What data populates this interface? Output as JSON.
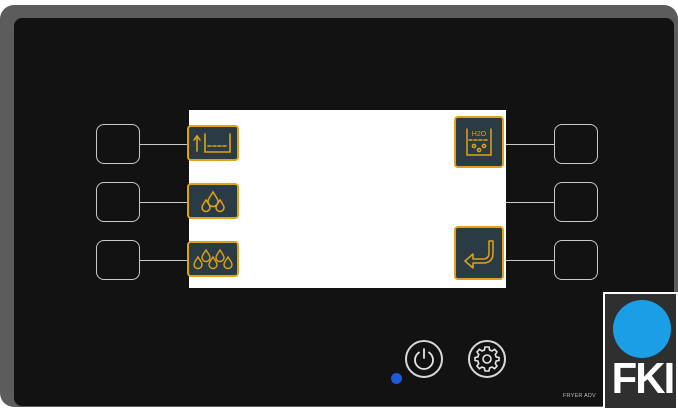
{
  "device": {
    "model_label": "FRYER ADV",
    "brand_logo_text": "FKI"
  },
  "softkeys_left": [
    {
      "icon": "vat-fill-icon"
    },
    {
      "icon": "two-drops-icon"
    },
    {
      "icon": "three-drops-icon"
    }
  ],
  "softkeys_right": [
    {
      "icon": "h2o-vat-icon",
      "label": "H2O"
    },
    {
      "icon": "empty-slot"
    },
    {
      "icon": "return-arrow-icon"
    }
  ],
  "bottom_buttons": [
    {
      "icon": "power-icon"
    },
    {
      "icon": "gear-icon"
    }
  ],
  "colors": {
    "accent": "#e0a21a",
    "softkey_fill": "#2a3b44",
    "panel": "#121212",
    "bezel": "#5c5c5c",
    "led": "#1e5bd6",
    "logo_circle": "#1b9ee6"
  }
}
